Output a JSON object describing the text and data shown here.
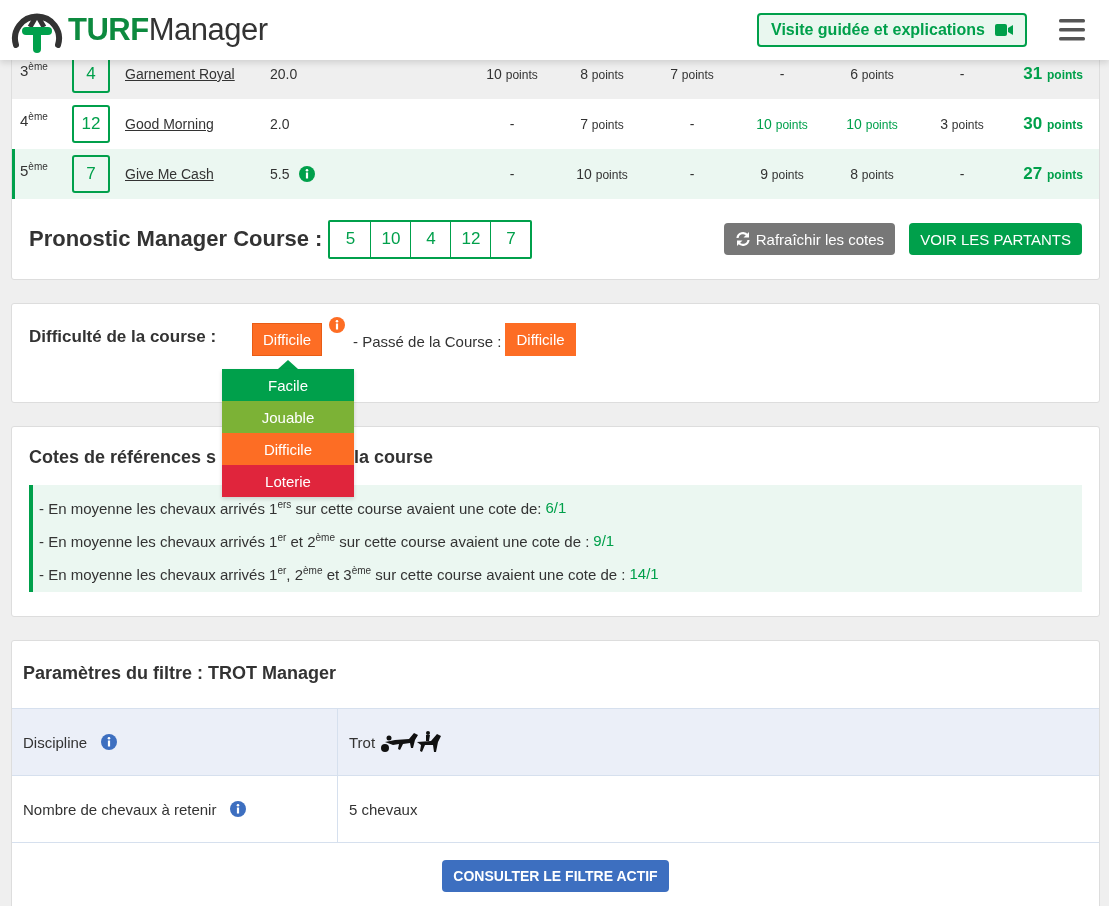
{
  "header": {
    "brand": "TURF",
    "brand_suffix": "Manager",
    "tour_button": "Visite guidée et explications"
  },
  "results": {
    "rows": [
      {
        "rank": "3$^{ème}$",
        "number": "4",
        "name": "Garnement Royal",
        "cote": "20.0",
        "info": false,
        "striped": true,
        "selected": false,
        "scores": [
          {
            "value": "10",
            "unit": "points",
            "good": false
          },
          {
            "value": "8",
            "unit": "points",
            "good": false
          },
          {
            "value": "7",
            "unit": "points",
            "good": false
          },
          {
            "value": "-",
            "good": false
          },
          {
            "value": "6",
            "unit": "points",
            "good": false
          },
          {
            "value": "-",
            "good": false
          }
        ],
        "total": {
          "value": "31",
          "unit": "points"
        }
      },
      {
        "rank": "4$^{ème}$",
        "number": "12",
        "name": "Good Morning",
        "cote": "2.0",
        "info": false,
        "striped": false,
        "selected": false,
        "scores": [
          {
            "value": "-",
            "good": false
          },
          {
            "value": "7",
            "unit": "points",
            "good": false
          },
          {
            "value": "-",
            "good": false
          },
          {
            "value": "10",
            "unit": "points",
            "good": true
          },
          {
            "value": "10",
            "unit": "points",
            "good": true
          },
          {
            "value": "3",
            "unit": "points",
            "good": false
          }
        ],
        "total": {
          "value": "30",
          "unit": "points"
        }
      },
      {
        "rank": "5$^{ème}$",
        "number": "7",
        "name": "Give Me Cash",
        "cote": "5.5",
        "info": true,
        "striped": false,
        "selected": true,
        "scores": [
          {
            "value": "-",
            "good": false
          },
          {
            "value": "10",
            "unit": "points",
            "good": false
          },
          {
            "value": "-",
            "good": false
          },
          {
            "value": "9",
            "unit": "points",
            "good": false
          },
          {
            "value": "8",
            "unit": "points",
            "good": false
          },
          {
            "value": "-",
            "good": false
          }
        ],
        "total": {
          "value": "27",
          "unit": "points"
        }
      }
    ],
    "pronostic": {
      "label": "Pronostic Manager Course :",
      "numbers": [
        "5",
        "10",
        "4",
        "12",
        "7"
      ]
    },
    "refresh_button": "Rafraîchir les cotes",
    "runners_button": "VOIR LES PARTANTS"
  },
  "difficulty": {
    "label": "Difficulté de la course :",
    "current": "Difficile",
    "expanded": true,
    "past_label": "- Passé de la Course :",
    "past": "Difficile",
    "menu": [
      {
        "label": "Facile",
        "color": "#00a04b"
      },
      {
        "label": "Jouable",
        "color": "#7cb236"
      },
      {
        "label": "Difficile",
        "color": "#fd6d24"
      },
      {
        "label": "Loterie",
        "color": "#e0253c"
      }
    ]
  },
  "reference_odds": {
    "heading_parts": [
      "Cotes de références s",
      "la course"
    ],
    "lines": [
      {
        "text": "- En moyenne les chevaux arrivés 1$^{ers}$ sur cette course avaient une cote de:",
        "value": "6/1"
      },
      {
        "text": "- En moyenne les chevaux arrivés 1$^{er}$ et 2$^{ème}$ sur cette course avaient une cote de :",
        "value": "9/1"
      },
      {
        "text": "- En moyenne les chevaux arrivés 1$^{er}$, 2$^{ème}$ et 3$^{ème}$ sur cette course avaient une cote de :",
        "value": "14/1"
      }
    ]
  },
  "filter": {
    "title": "Paramètres du filtre : TROT Manager",
    "rows": [
      {
        "kind": "discipline",
        "label": "Discipline",
        "value": "Trot",
        "shaded": true
      },
      {
        "kind": "plain",
        "label": "Nombre de chevaux à retenir",
        "value": "5 chevaux",
        "shaded": false
      }
    ],
    "button": "CONSULTER LE FILTRE ACTIF"
  }
}
